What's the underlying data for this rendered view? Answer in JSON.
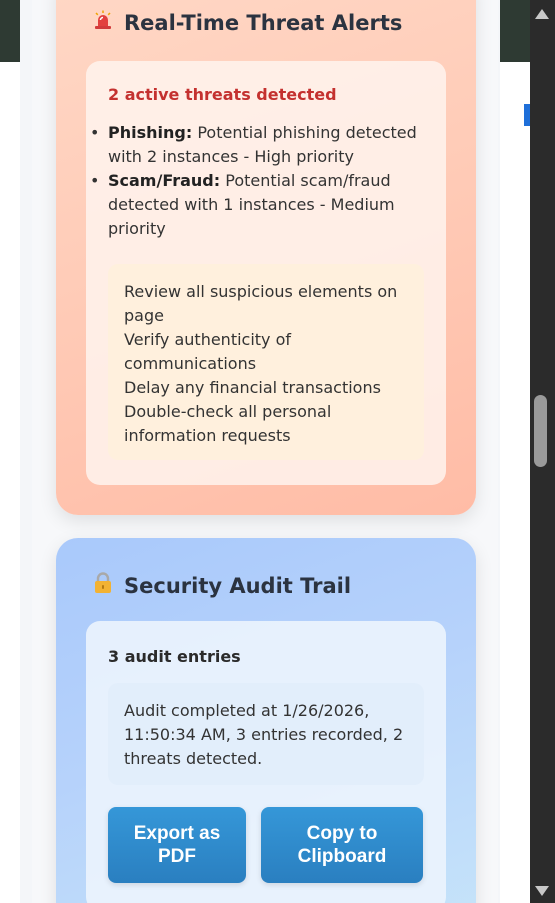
{
  "alerts": {
    "icon": "siren-icon",
    "title": "Real-Time Threat Alerts",
    "count_text": "2 active threats detected",
    "threats": [
      {
        "type": "Phishing:",
        "text": "Potential phishing detected with 2 instances - High priority"
      },
      {
        "type": "Scam/Fraud:",
        "text": "Potential scam/fraud detected with 1 instances - Medium priority"
      }
    ],
    "recommendations": [
      "Review all suspicious elements on page",
      "Verify authenticity of communications",
      "Delay any financial transactions",
      "Double-check all personal information requests"
    ]
  },
  "audit": {
    "icon": "lock-icon",
    "title": "Security Audit Trail",
    "count_text": "3 audit entries",
    "summary": "Audit completed at 1/26/2026, 11:50:34 AM, 3 entries recorded, 2 threats detected.",
    "export_label": "Export as PDF",
    "copy_label": "Copy to Clipboard"
  },
  "colors": {
    "alert_red": "#c4312f",
    "button_blue": "#2a7fc0",
    "alerts_card": "#ffccb8",
    "audit_card": "#b6d2fb"
  }
}
